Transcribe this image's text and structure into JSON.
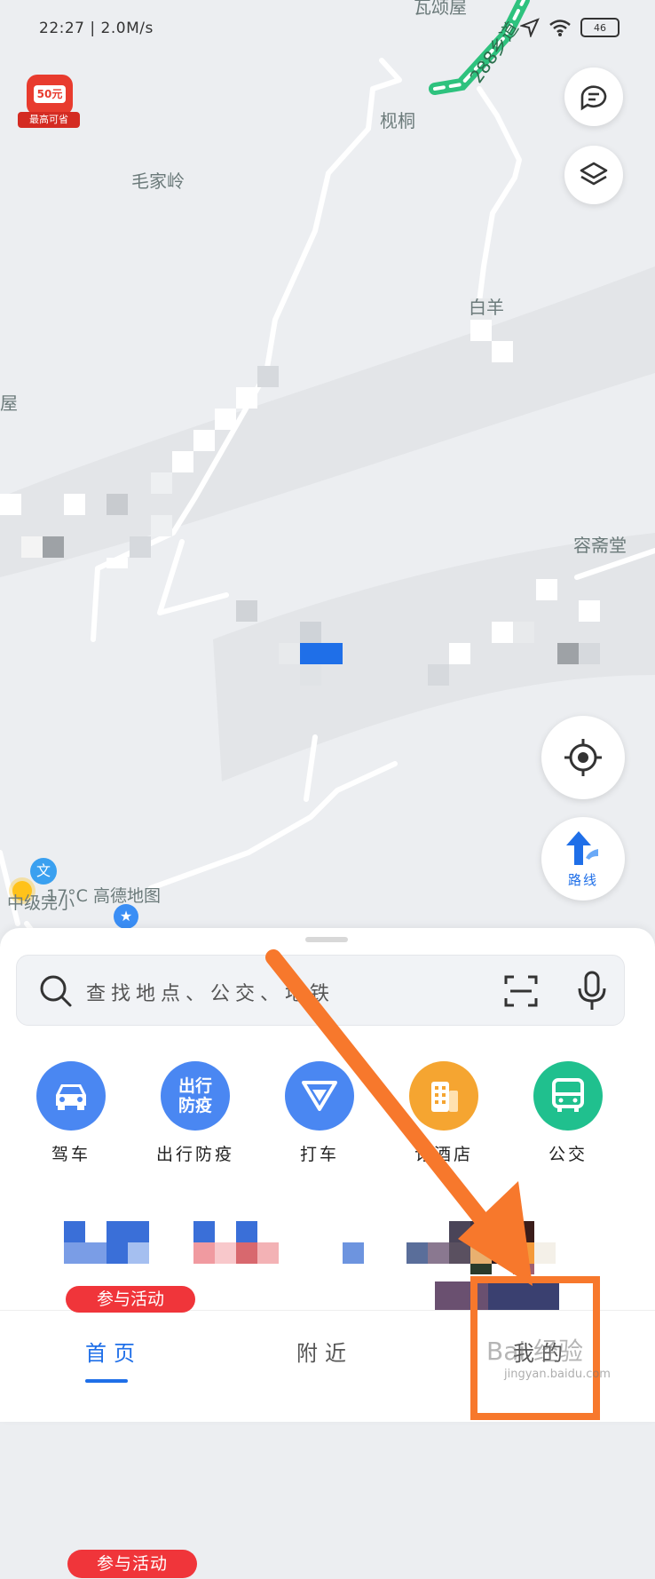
{
  "status_bar": {
    "time": "22:27",
    "network_speed": "2.0M/s",
    "battery": "46"
  },
  "map": {
    "road_label": "288乡道",
    "places": [
      "瓦颂屋",
      "枧桐",
      "毛家岭",
      "屋",
      "白羊",
      "容斋堂"
    ],
    "poi_label": "17°C 高德地图",
    "poi_prefix": "中级完小",
    "poi_badge": "文"
  },
  "promo": {
    "amount": "50元",
    "tag": "最高可省"
  },
  "controls": {
    "route_label": "路线"
  },
  "search": {
    "placeholder": "查找地点、公交、地铁"
  },
  "services": [
    {
      "label": "驾车",
      "icon": "car-icon",
      "color": "#4a87f2"
    },
    {
      "label": "出行防疫",
      "icon": "epidemic-icon",
      "icon_text_top": "出行",
      "icon_text_bottom": "防疫",
      "color": "#4a87f2"
    },
    {
      "label": "打车",
      "icon": "taxi-icon",
      "color": "#4a87f2"
    },
    {
      "label": "订酒店",
      "icon": "hotel-icon",
      "color": "#f5a531"
    },
    {
      "label": "公交",
      "icon": "bus-icon",
      "color": "#20c08e"
    }
  ],
  "activity_badge": "参与活动",
  "tabs": [
    {
      "label": "首页",
      "active": true
    },
    {
      "label": "附近",
      "active": false
    },
    {
      "label": "我的",
      "active": false
    }
  ],
  "watermark": {
    "main": "Bai 经验",
    "sub": "jingyan.baidu.com"
  },
  "colors": {
    "accent": "#1f6fe8",
    "arrow": "#f7782c",
    "road_green": "#2ec27e"
  }
}
